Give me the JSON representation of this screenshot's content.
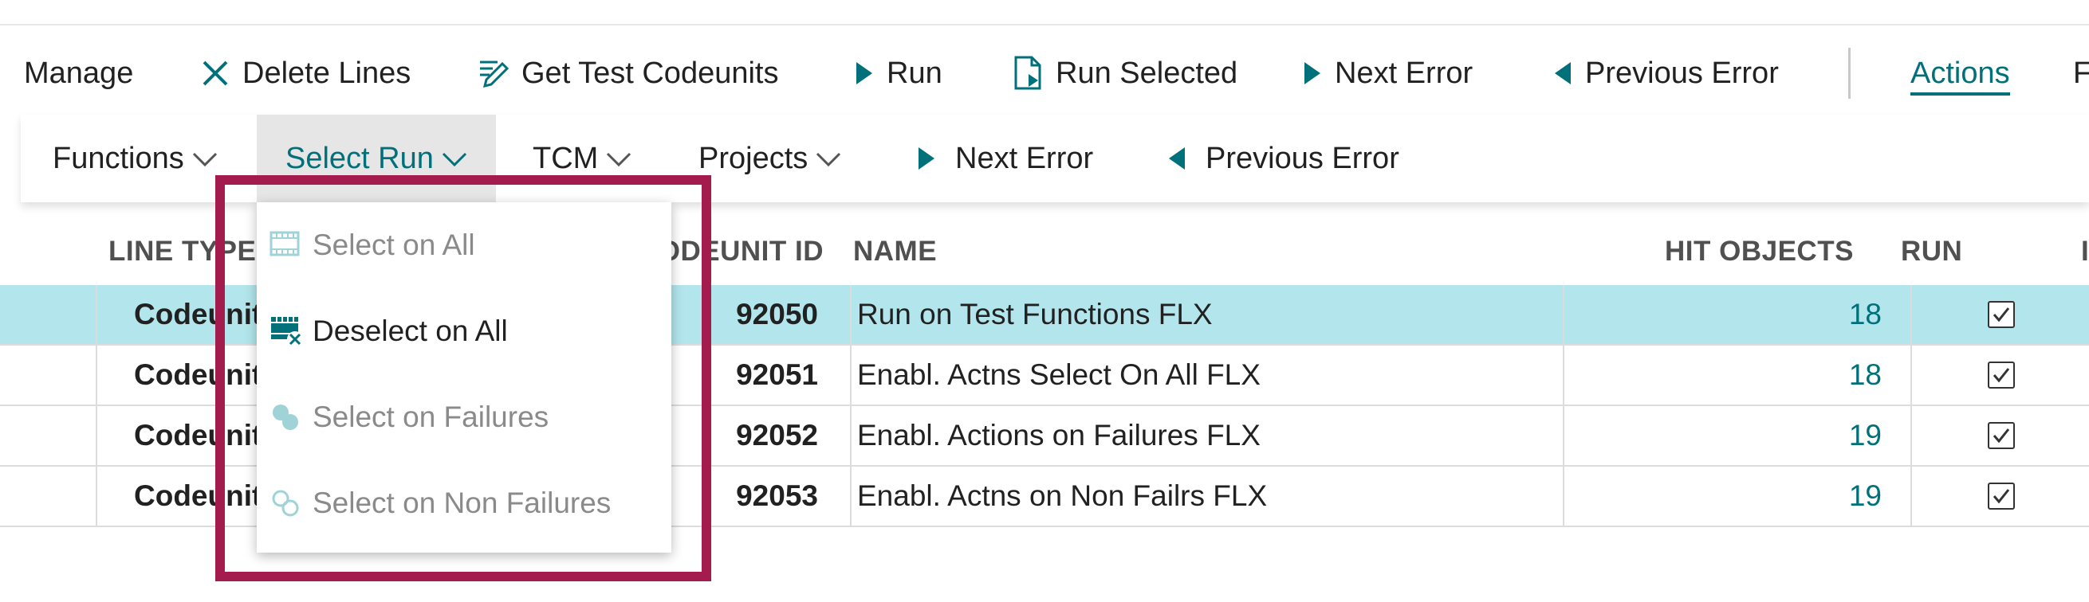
{
  "action_bar": {
    "manage": "Manage",
    "delete_lines": "Delete Lines",
    "get_test_codeunits": "Get Test Codeunits",
    "run": "Run",
    "run_selected": "Run Selected",
    "next_error": "Next Error",
    "previous_error": "Previous Error",
    "actions": "Actions",
    "overflow": "F"
  },
  "sub_bar": {
    "functions": "Functions",
    "select_run": "Select Run",
    "tcm": "TCM",
    "projects": "Projects",
    "next_error": "Next Error",
    "previous_error": "Previous Error"
  },
  "dropdown": {
    "items": [
      {
        "label": "Select on All",
        "enabled": false
      },
      {
        "label": "Deselect on All",
        "enabled": true
      },
      {
        "label": "Select on Failures",
        "enabled": false
      },
      {
        "label": "Select on Non Failures",
        "enabled": false
      }
    ]
  },
  "table": {
    "headers": {
      "line_type": "LINE TYPE",
      "codeunit_id": "CODEUNIT ID",
      "name": "NAME",
      "hit_objects": "HIT OBJECTS",
      "run": "RUN",
      "overflow": "I"
    },
    "rows": [
      {
        "line_type": "Codeunit",
        "codeunit_id": "92050",
        "name": "Run on Test Functions FLX",
        "hit_objects": "18",
        "run": true,
        "selected": true
      },
      {
        "line_type": "Codeunit",
        "codeunit_id": "92051",
        "name": "Enabl. Actns Select On All FLX",
        "hit_objects": "18",
        "run": true,
        "selected": false
      },
      {
        "line_type": "Codeunit",
        "codeunit_id": "92052",
        "name": "Enabl. Actions on Failures FLX",
        "hit_objects": "19",
        "run": true,
        "selected": false
      },
      {
        "line_type": "Codeunit",
        "codeunit_id": "92053",
        "name": "Enabl. Actns on Non Failrs FLX",
        "hit_objects": "19",
        "run": true,
        "selected": false
      }
    ]
  },
  "colors": {
    "accent": "#00707a",
    "selected_row": "#b2e6ec",
    "highlight_frame": "#a41b4d"
  }
}
